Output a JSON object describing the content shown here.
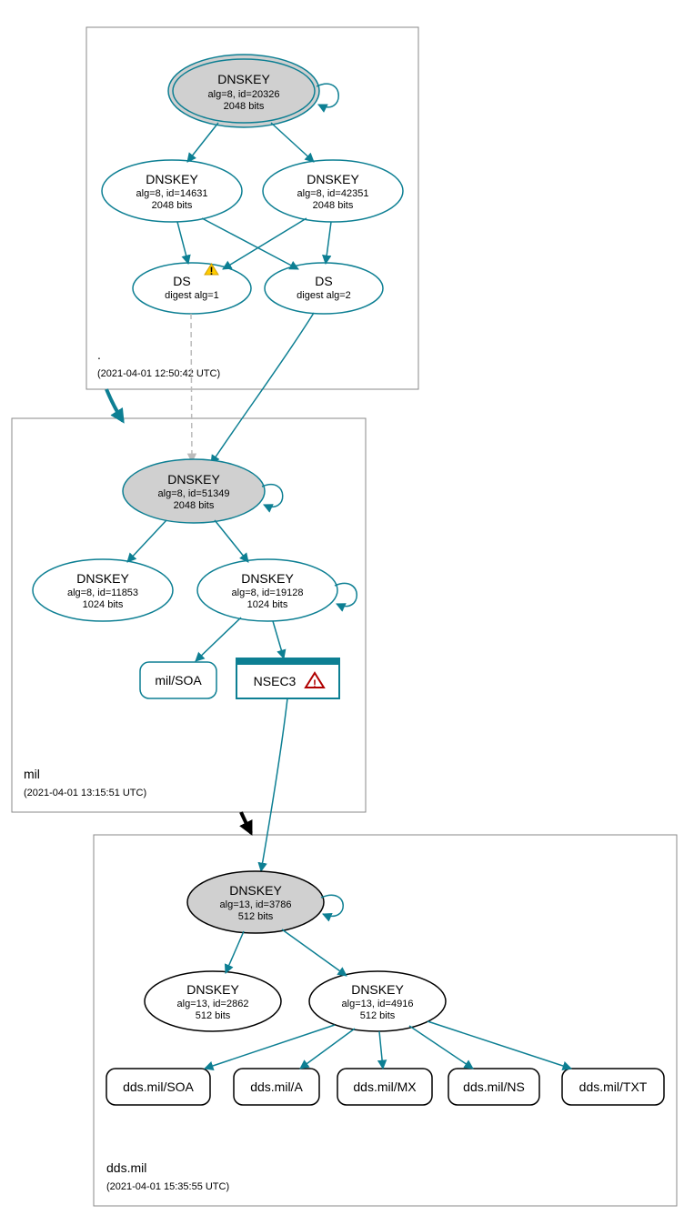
{
  "zones": {
    "root": {
      "name": ".",
      "timestamp": "(2021-04-01 12:50:42 UTC)",
      "keys": {
        "ksk": {
          "title": "DNSKEY",
          "line1": "alg=8, id=20326",
          "line2": "2048 bits"
        },
        "zsk1": {
          "title": "DNSKEY",
          "line1": "alg=8, id=14631",
          "line2": "2048 bits"
        },
        "zsk2": {
          "title": "DNSKEY",
          "line1": "alg=8, id=42351",
          "line2": "2048 bits"
        }
      },
      "ds": {
        "ds1": {
          "title": "DS",
          "line1": "digest alg=1"
        },
        "ds2": {
          "title": "DS",
          "line1": "digest alg=2"
        }
      }
    },
    "mil": {
      "name": "mil",
      "timestamp": "(2021-04-01 13:15:51 UTC)",
      "keys": {
        "ksk": {
          "title": "DNSKEY",
          "line1": "alg=8, id=51349",
          "line2": "2048 bits"
        },
        "zsk1": {
          "title": "DNSKEY",
          "line1": "alg=8, id=11853",
          "line2": "1024 bits"
        },
        "zsk2": {
          "title": "DNSKEY",
          "line1": "alg=8, id=19128",
          "line2": "1024 bits"
        }
      },
      "records": {
        "soa": "mil/SOA",
        "nsec3": "NSEC3"
      }
    },
    "dds": {
      "name": "dds.mil",
      "timestamp": "(2021-04-01 15:35:55 UTC)",
      "keys": {
        "ksk": {
          "title": "DNSKEY",
          "line1": "alg=13, id=3786",
          "line2": "512 bits"
        },
        "zsk1": {
          "title": "DNSKEY",
          "line1": "alg=13, id=2862",
          "line2": "512 bits"
        },
        "zsk2": {
          "title": "DNSKEY",
          "line1": "alg=13, id=4916",
          "line2": "512 bits"
        }
      },
      "records": {
        "soa": "dds.mil/SOA",
        "a": "dds.mil/A",
        "mx": "dds.mil/MX",
        "ns": "dds.mil/NS",
        "txt": "dds.mil/TXT"
      }
    }
  }
}
